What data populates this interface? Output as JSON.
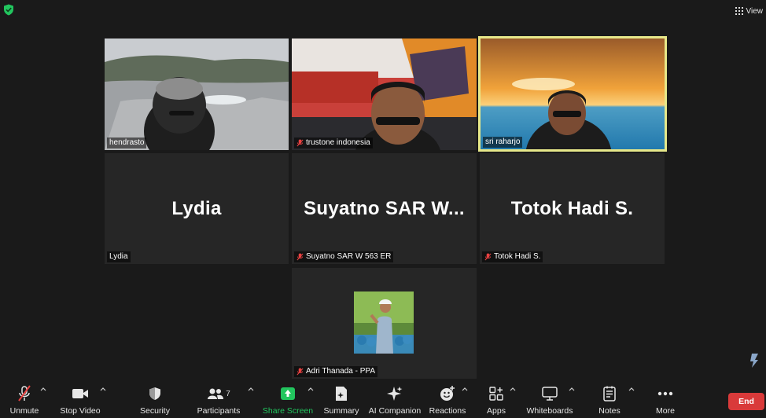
{
  "top": {
    "view_label": "View"
  },
  "participants": [
    {
      "label": "hendrasto",
      "muted": false
    },
    {
      "label": "trustone indonesia",
      "muted": true
    },
    {
      "label": "sri raharjo",
      "muted": false
    },
    {
      "label": "Lydia",
      "big_name": "Lydia",
      "muted": false
    },
    {
      "label": "Suyatno SAR W 563 ER",
      "big_name": "Suyatno SAR W...",
      "muted": true
    },
    {
      "label": "Totok Hadi S.",
      "big_name": "Totok Hadi S.",
      "muted": true
    },
    {
      "label": "Adri Thanada - PPA",
      "muted": true
    }
  ],
  "toolbar": {
    "unmute": "Unmute",
    "stop_video": "Stop Video",
    "security": "Security",
    "participants": "Participants",
    "participant_count": "7",
    "share_screen": "Share Screen",
    "summary": "Summary",
    "ai_companion": "AI Companion",
    "reactions": "Reactions",
    "apps": "Apps",
    "whiteboards": "Whiteboards",
    "notes": "Notes",
    "more": "More",
    "end": "End"
  },
  "colors": {
    "accent_green": "#22c55e",
    "end_red": "#d93a3a",
    "active_border": "#e7e88a"
  }
}
